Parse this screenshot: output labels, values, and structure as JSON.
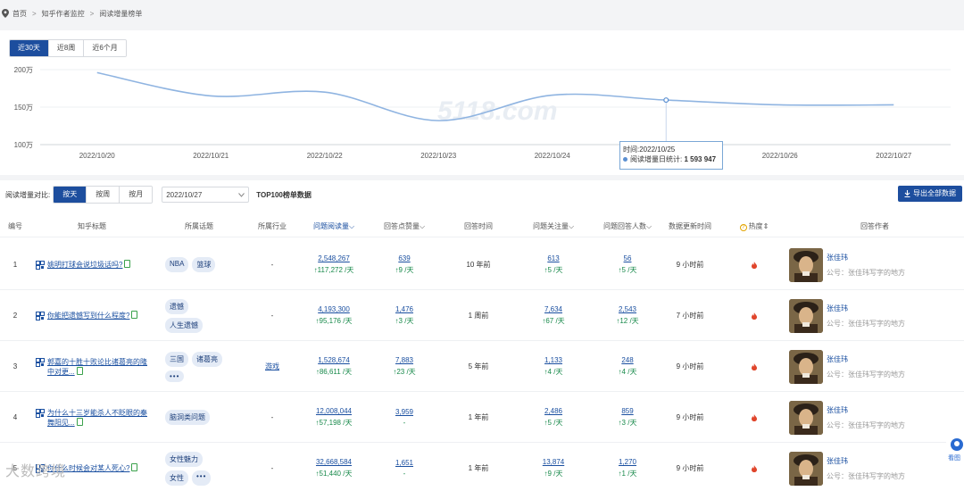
{
  "breadcrumb": [
    "首页",
    ">",
    "知乎作者监控",
    ">",
    "阅读增量榜单"
  ],
  "range_tabs": [
    "近30天",
    "近8周",
    "近6个月"
  ],
  "chart_data": {
    "type": "line",
    "x": [
      "2022/10/20",
      "2022/10/21",
      "2022/10/22",
      "2022/10/23",
      "2022/10/24",
      "2022/10/25",
      "2022/10/26",
      "2022/10/27"
    ],
    "y_ticks": [
      "200万",
      "150万",
      "100万"
    ],
    "ylim": [
      100,
      200
    ],
    "series": [
      {
        "values": [
          196,
          165,
          170,
          132,
          166,
          159.4,
          153,
          153
        ]
      }
    ],
    "watermark": "5118.com",
    "tooltip": {
      "time_label": "时间:2022/10/25",
      "value_label": "阅读增量日统计:",
      "value": "1 593 947"
    },
    "colors": {
      "line": "#8fb4e1",
      "dot": "#5b8fd1"
    }
  },
  "filter": {
    "label": "阅读增量对比:",
    "buttons": [
      "按天",
      "按周",
      "按月"
    ],
    "date": "2022/10/27",
    "top100": "TOP100榜单数据",
    "export": "导出全部数据"
  },
  "headers": [
    "编号",
    "知乎标题",
    "所属话题",
    "所属行业",
    "问题阅读量",
    "回答点赞量",
    "回答时间",
    "问题关注量",
    "问题回答人数",
    "数据更新时间",
    "热度",
    "回答作者"
  ],
  "rows": [
    {
      "no": "1",
      "title": "姚明打球会说垃圾话吗?",
      "tags": [
        "NBA",
        "篮球"
      ],
      "more": false,
      "industry": "-",
      "reads": "2,548,267",
      "reads_g": "↑117,272 /天",
      "likes": "639",
      "likes_g": "↑9 /天",
      "time": "10 年前",
      "follows": "613",
      "follows_g": "↑5 /天",
      "answers": "56",
      "answers_g": "↑5 /天",
      "update": "9 小时前",
      "author": "张佳玮",
      "author_sub": "公号：张佳玮写字的地方"
    },
    {
      "no": "2",
      "title": "你能把遗憾写到什么程度?",
      "tags": [
        "遗憾",
        "人生遗憾"
      ],
      "more": false,
      "industry": "-",
      "reads": "4,193,300",
      "reads_g": "↑95,176 /天",
      "likes": "1,476",
      "likes_g": "↑3 /天",
      "time": "1 周前",
      "follows": "7,634",
      "follows_g": "↑67 /天",
      "answers": "2,543",
      "answers_g": "↑12 /天",
      "update": "7 小时前",
      "author": "张佳玮",
      "author_sub": "公号：张佳玮写字的地方"
    },
    {
      "no": "3",
      "title": "郭嘉的十胜十败论比诸葛亮的隆中对更...",
      "tags": [
        "三国",
        "诸葛亮"
      ],
      "more": true,
      "industry": "游戏",
      "reads": "1,528,674",
      "reads_g": "↑86,611 /天",
      "likes": "7,883",
      "likes_g": "↑23 /天",
      "time": "5 年前",
      "follows": "1,133",
      "follows_g": "↑4 /天",
      "answers": "248",
      "answers_g": "↑4 /天",
      "update": "9 小时前",
      "author": "张佳玮",
      "author_sub": "公号：张佳玮写字的地方"
    },
    {
      "no": "4",
      "title": "为什么十三岁能杀人不眨眼的秦舞阳见...",
      "tags": [
        "脑洞类问题"
      ],
      "more": false,
      "industry": "-",
      "reads": "12,008,044",
      "reads_g": "↑57,198 /天",
      "likes": "3,959",
      "likes_g": "-",
      "time": "1 年前",
      "follows": "2,486",
      "follows_g": "↑5 /天",
      "answers": "859",
      "answers_g": "↑3 /天",
      "update": "9 小时前",
      "author": "张佳玮",
      "author_sub": "公号：张佳玮写字的地方"
    },
    {
      "no": "5",
      "title": "你什么时候会对某人死心?",
      "tags": [
        "女性魅力",
        "女性"
      ],
      "more": true,
      "industry": "-",
      "reads": "32,668,584",
      "reads_g": "↑51,440 /天",
      "likes": "1,651",
      "likes_g": "-",
      "time": "1 年前",
      "follows": "13,874",
      "follows_g": "↑9 /天",
      "answers": "1,270",
      "answers_g": "↑1 /天",
      "update": "9 小时前",
      "author": "张佳玮",
      "author_sub": "公号：张佳玮写字的地方"
    }
  ],
  "side_watermark": "大数跨境",
  "float_label": "看图"
}
